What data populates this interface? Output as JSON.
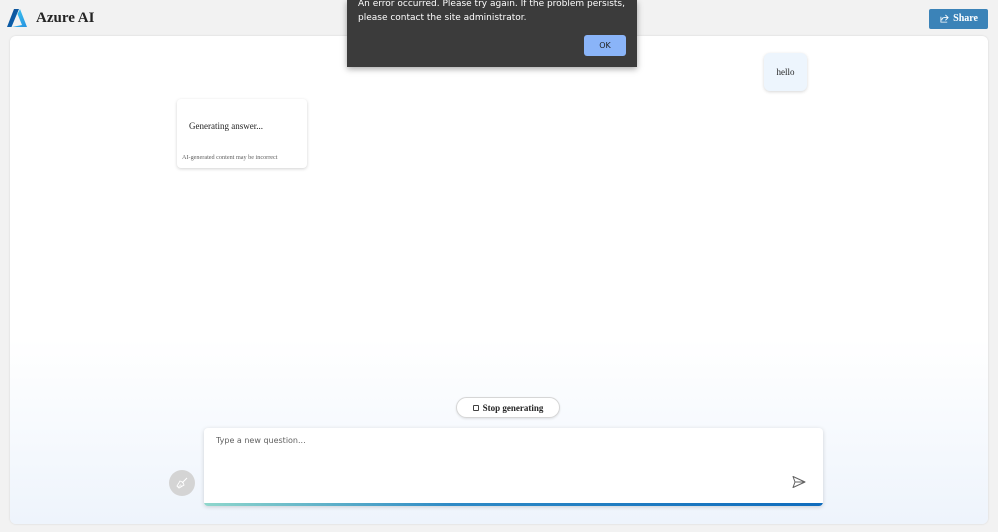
{
  "header": {
    "logo_icon": "azure-logo-icon",
    "title": "Azure AI",
    "share_icon": "share-icon",
    "share_label": "Share",
    "share_color": "#3b83b8"
  },
  "chat": {
    "user_message": "hello",
    "answer": {
      "text": "Generating answer...",
      "disclaimer": "AI-generated content may be incorrect"
    }
  },
  "controls": {
    "stop_icon": "stop-icon",
    "stop_label": "Stop generating",
    "clear_icon": "broom-icon",
    "send_icon": "send-icon"
  },
  "input": {
    "placeholder": "Type a new question...",
    "value": ""
  },
  "alert": {
    "message": "An error occurred. Please try again. If the problem persists, please contact the site administrator.",
    "ok_label": "OK",
    "background": "#3b3b3b",
    "button_color": "#8ab4f8"
  }
}
